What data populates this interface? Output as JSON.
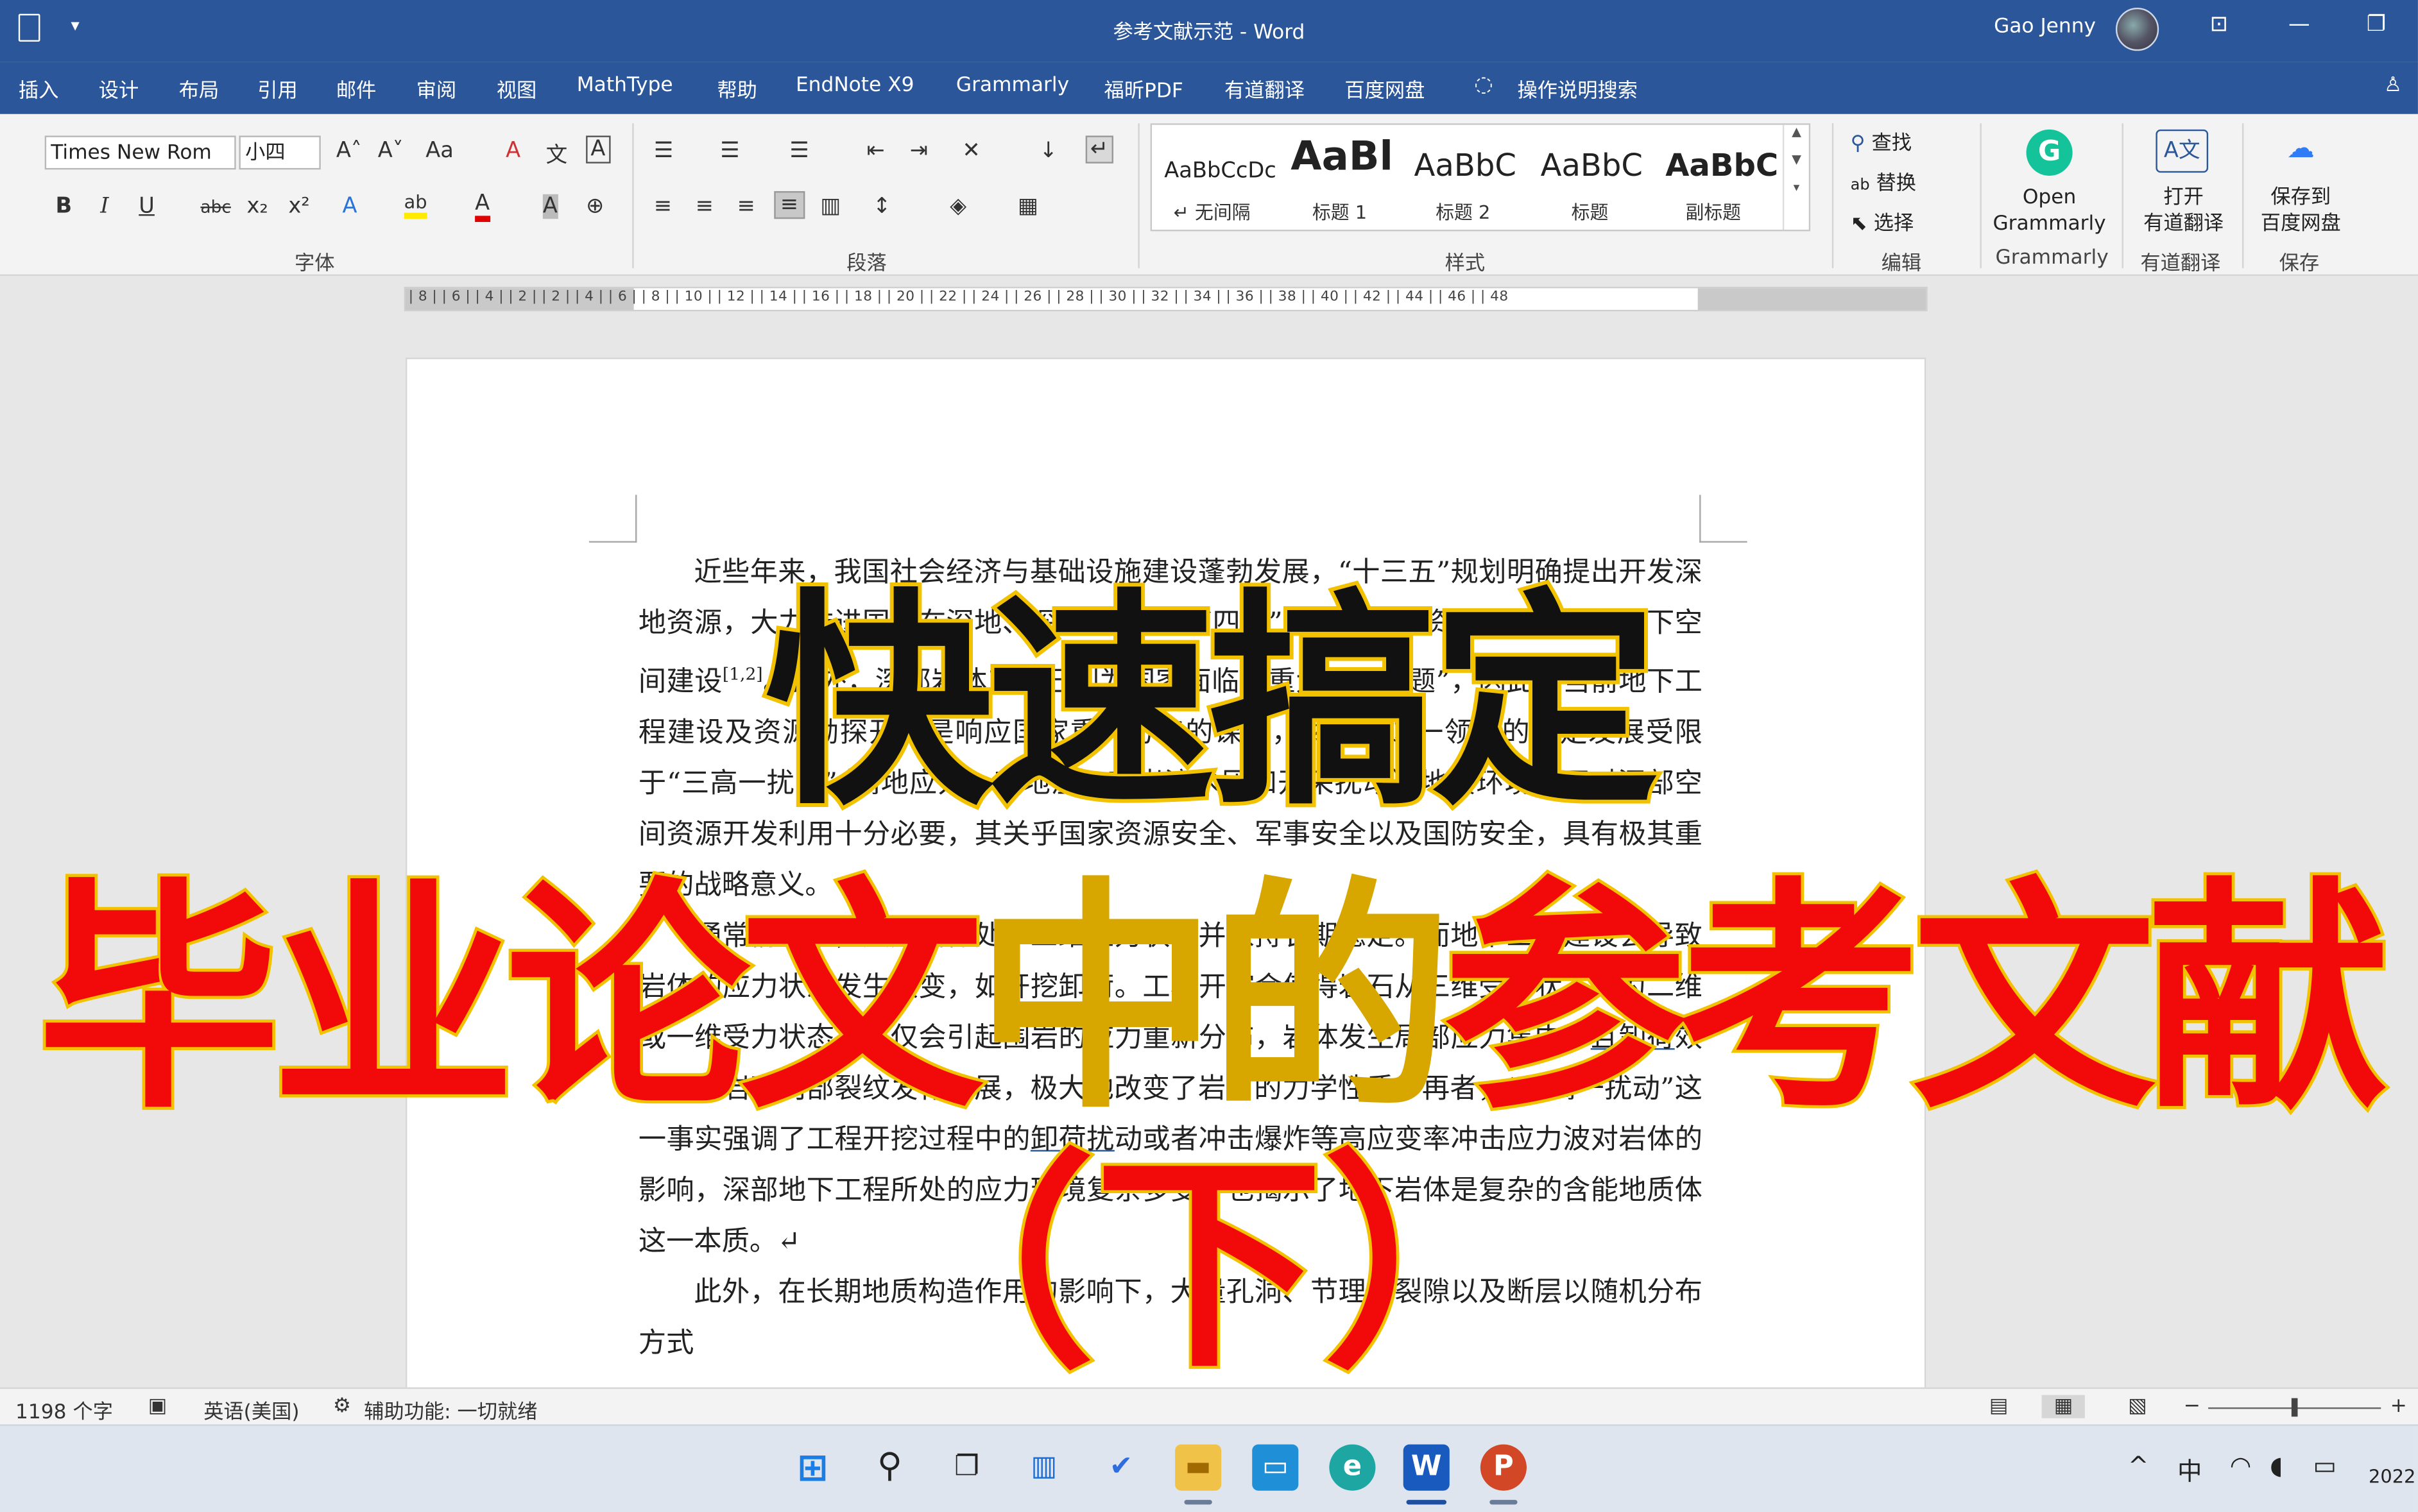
{
  "titlebar": {
    "doc_title": "参考文献示范 - Word",
    "user": "Gao Jenny",
    "qat_dropdown": "▾",
    "ribbon_display": "⊡",
    "minimize": "—",
    "restore": "❐"
  },
  "menu": {
    "tabs": [
      "插入",
      "设计",
      "布局",
      "引用",
      "邮件",
      "审阅",
      "视图",
      "MathType",
      "帮助",
      "EndNote X9",
      "Grammarly",
      "福昕PDF",
      "有道翻译",
      "百度网盘"
    ],
    "search_hint": "操作说明搜索",
    "share_icon": "♙"
  },
  "ribbon": {
    "font_name": "Times New Rom",
    "font_size": "小四",
    "font_group_label": "字体",
    "paragraph_group_label": "段落",
    "styles_group_label": "样式",
    "editing_group_label": "编辑",
    "font_buttons": {
      "grow": "A˄",
      "shrink": "A˅",
      "case": "Aa",
      "clear": "A",
      "phonetic": "文",
      "border": "A",
      "bold": "B",
      "italic": "I",
      "underline": "U",
      "strike": "abc",
      "subscript": "x₂",
      "superscript": "x²",
      "effects": "A",
      "highlight": "ab",
      "font_color": "A",
      "shading": "A",
      "enclose": "⊕"
    },
    "styles": [
      {
        "preview": "AaBbCcDc",
        "name": "↵ 无间隔"
      },
      {
        "preview": "AaBl",
        "name": "标题 1"
      },
      {
        "preview": "AaBbC",
        "name": "标题 2"
      },
      {
        "preview": "AaBbC",
        "name": "标题"
      },
      {
        "preview": "AaBbC",
        "name": "副标题"
      }
    ],
    "editing": {
      "find": "查找",
      "replace": "替换",
      "select": "选择"
    },
    "grammarly": {
      "line1": "Open",
      "line2": "Grammarly",
      "group": "Grammarly"
    },
    "youdao": {
      "line1": "打开",
      "line2": "有道翻译",
      "group": "有道翻译"
    },
    "baidu": {
      "line1": "保存到",
      "line2": "百度网盘",
      "group": "保存"
    }
  },
  "ruler": {
    "ticks": "| 8 |  | 6 |  | 4 |  | 2 |     | 2 |  | 4 |  | 6 |  | 8 |  | 10 |  | 12 |  | 14 |  | 16 |  | 18 |  | 20 |  | 22 |  | 24 |  | 26 |  | 28 |  | 30 |  | 32 |  | 34 |  | 36 |  | 38 |  | 40 |  | 42 |  | 44 |  | 46 |  | 48"
  },
  "document": {
    "p1_a": "近些年来，我国社会经济与基础设施建设蓬勃发展，“十三五”规划明确提出开发深地资源，大力推进国家在深地、深海、深蓝的“四深”战略，深部资源开采、深部地下空间建设",
    "p1_cite": "[1,2]",
    "p1_b": "。此外，深部岩体工程已列为国家面临的重大科技问题”，因此，当前地下工程建设及资源勘探开发是响应国家重大方略的课题，然而，这一领域的长足发展受限于“三高一扰动”（高地应力、高地温、高岩溶水压和开采扰动）地质环境，面对深部空间资源开发利用十分必要，其关乎国家资源安全、军事安全以及国防安全，具有极其重要的战略意义。",
    "p2_a": "通常情况下，天然岩体处于三维应力状态并保持长期稳定。而地下工程建设会导致岩体的应力状态发生改变，如开挖卸荷。工程开挖会使得岩石从三维受力状态变为二维或一维受力状态，不仅会引起围岩的应力重新分布，岩体发生局部应力集中，",
    "p2_ul1": "且卸荷",
    "p2_b": "效应致使岩石内部裂纹发育扩展，极大地改变了岩石的力学性质。再者，“三高一扰动”这一事实强调了工程开挖过程中的",
    "p2_ul2": "卸荷扰",
    "p2_c": "动或者冲击爆炸等高应变率冲击应力波对岩体的影响，深部地下工程所处的应力环境复杂多变，也揭示了地下岩体是复杂的含能地质体这一本质。↵",
    "p3": "此外，在长期地质构造作用的影响下，大量孔洞、节理、裂隙以及断层以随机分布方式"
  },
  "overlay": {
    "line1": "快速搞定",
    "line2_red1": "毕业论文",
    "line2_gold": "中的",
    "line2_red2": "参考文献",
    "line3": "（下）"
  },
  "statusbar": {
    "word_count": "1198 个字",
    "language": "英语(美国)",
    "accessibility": "辅助功能: 一切就绪",
    "zoom_minus": "−",
    "zoom_plus": "+"
  },
  "taskbar": {
    "tray_ime": "中",
    "tray_year": "2022",
    "tray_chevron": "^"
  },
  "colors": {
    "word_blue": "#2b579a",
    "overlay_red": "#f20a0a",
    "overlay_gold": "#d7a700",
    "overlay_stroke": "#f2c200"
  }
}
